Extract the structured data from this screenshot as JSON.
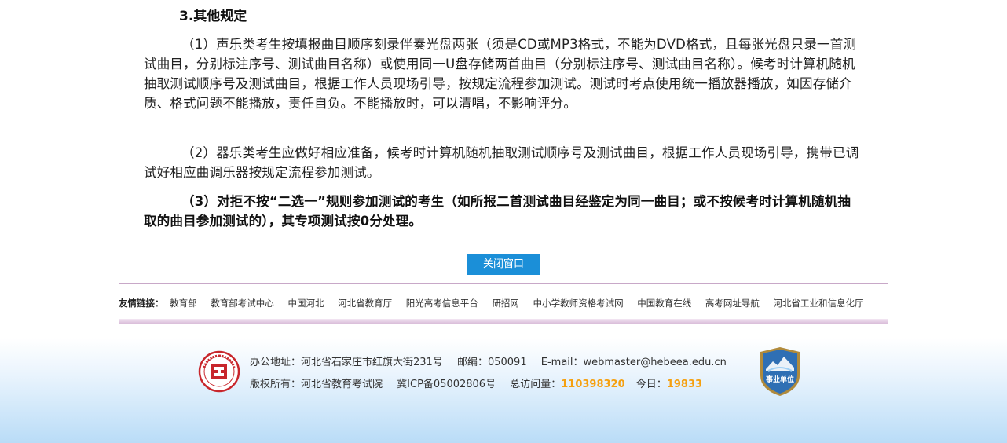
{
  "section": {
    "title": "3.其他规定",
    "paragraphs": [
      "（1）声乐类考生按填报曲目顺序刻录伴奏光盘两张（须是CD或MP3格式，不能为DVD格式，且每张光盘只录一首测试曲目，分别标注序号、测试曲目名称）或使用同一U盘存储两首曲目（分别标注序号、测试曲目名称）。候考时计算机随机抽取测试顺序号及测试曲目，根据工作人员现场引导，按规定流程参加测试。测试时考点使用统一播放器播放，如因存储介质、格式问题不能播放，责任自负。不能播放时，可以清唱，不影响评分。",
      "（2）器乐类考生应做好相应准备，候考时计算机随机抽取测试顺序号及测试曲目，根据工作人员现场引导，携带已调试好相应曲调乐器按规定流程参加测试。",
      "（3）对拒不按“二选一”规则参加测试的考生（如所报二首测试曲目经鉴定为同一曲目；或不按候考时计算机随机抽取的曲目参加测试的），其专项测试按0分处理。"
    ]
  },
  "close_button": "关闭窗口",
  "links": {
    "label": "友情链接：",
    "items": [
      "教育部",
      "教育部考试中心",
      "中国河北",
      "河北省教育厅",
      "阳光高考信息平台",
      "研招网",
      "中小学教师资格考试网",
      "中国教育在线",
      "高考网址导航",
      "河北省工业和信息化厅"
    ]
  },
  "footer": {
    "address": "办公地址：河北省石家庄市红旗大街231号",
    "postcode": "邮编：050091",
    "email": "E-mail：webmaster@hebeea.edu.cn",
    "copyright": "版权所有：河北省教育考试院",
    "icp": "冀ICP备05002806号",
    "total_label": "总访问量：",
    "total_value": "110398320",
    "today_label": "今日：",
    "today_value": "19833",
    "badge_text": "事业单位"
  },
  "colors": {
    "button": "#1b8fd8",
    "highlight": "#f5a010",
    "seal": "#c8262c",
    "badge": "#2f6fb4"
  }
}
